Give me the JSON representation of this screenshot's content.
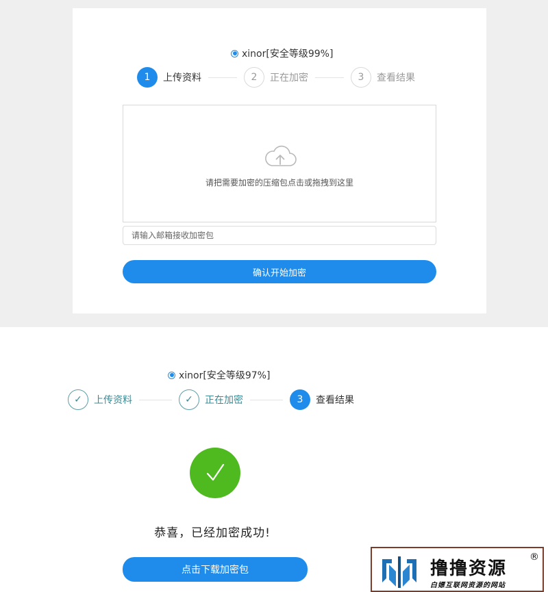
{
  "panel1": {
    "option_label": "xinor[安全等级99%]",
    "steps": [
      {
        "num": "1",
        "label": "上传资料",
        "state": "active"
      },
      {
        "num": "2",
        "label": "正在加密",
        "state": "inactive"
      },
      {
        "num": "3",
        "label": "查看结果",
        "state": "inactive"
      }
    ],
    "dropzone_text": "请把需要加密的压缩包点击或拖拽到这里",
    "email_placeholder": "请输入邮箱接收加密包",
    "confirm_button": "确认开始加密"
  },
  "panel2": {
    "option_label": "xinor[安全等级97%]",
    "steps": [
      {
        "num": "✓",
        "label": "上传资料",
        "state": "done"
      },
      {
        "num": "✓",
        "label": "正在加密",
        "state": "done"
      },
      {
        "num": "3",
        "label": "查看结果",
        "state": "active"
      }
    ],
    "success_message": "恭喜，已经加密成功!",
    "download_button": "点击下载加密包"
  },
  "watermark": {
    "title": "撸撸资源",
    "registered": "®",
    "subtitle": "白嫖互联网资源的网站"
  },
  "colors": {
    "primary": "#1f8ceb",
    "success": "#4fba20",
    "done_step": "#3c8a94",
    "page_bg": "#efefef"
  }
}
